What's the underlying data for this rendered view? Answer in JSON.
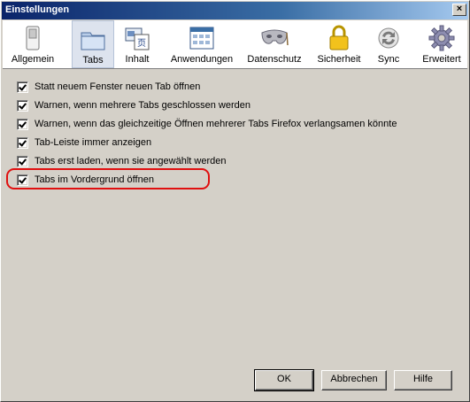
{
  "window": {
    "title": "Einstellungen"
  },
  "toolbar": {
    "items": [
      {
        "label": "Allgemein",
        "icon": "switch-icon"
      },
      {
        "label": "Tabs",
        "icon": "tabs-folder-icon",
        "selected": true
      },
      {
        "label": "Inhalt",
        "icon": "content-icon"
      },
      {
        "label": "Anwendungen",
        "icon": "applications-icon"
      },
      {
        "label": "Datenschutz",
        "icon": "mask-icon"
      },
      {
        "label": "Sicherheit",
        "icon": "lock-icon"
      },
      {
        "label": "Sync",
        "icon": "sync-icon"
      },
      {
        "label": "Erweitert",
        "icon": "gear-icon"
      }
    ]
  },
  "options": [
    {
      "label": "Statt neuem Fenster neuen Tab öffnen",
      "checked": true
    },
    {
      "label": "Warnen, wenn mehrere Tabs geschlossen werden",
      "checked": true
    },
    {
      "label": "Warnen, wenn das gleichzeitige Öffnen mehrerer Tabs Firefox verlangsamen könnte",
      "checked": true
    },
    {
      "label": "Tab-Leiste immer anzeigen",
      "checked": true
    },
    {
      "label": "Tabs erst laden, wenn sie angewählt werden",
      "checked": true
    },
    {
      "label": "Tabs im Vordergrund öffnen",
      "checked": true
    }
  ],
  "buttons": {
    "ok": "OK",
    "cancel": "Abbrechen",
    "help": "Hilfe"
  },
  "colors": {
    "highlight": "#e01010",
    "titlebar": "#0a246a",
    "selected_tab": "#dde3ee"
  }
}
